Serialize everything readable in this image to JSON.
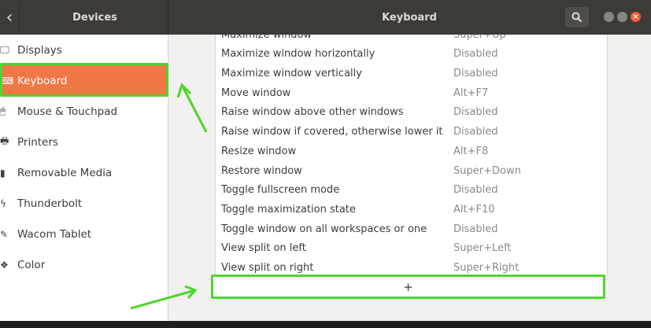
{
  "header": {
    "back_glyph": "‹",
    "left_title": "Devices",
    "main_title": "Keyboard",
    "close_glyph": "×"
  },
  "sidebar": {
    "items": [
      {
        "label": "Displays",
        "icon": "display-icon",
        "glyph": "🖵"
      },
      {
        "label": "Keyboard",
        "icon": "keyboard-icon",
        "glyph": "⌨",
        "active": true
      },
      {
        "label": "Mouse & Touchpad",
        "icon": "mouse-icon",
        "glyph": "🖱"
      },
      {
        "label": "Printers",
        "icon": "printer-icon",
        "glyph": "🖶"
      },
      {
        "label": "Removable Media",
        "icon": "usb-drive-icon",
        "glyph": "▮"
      },
      {
        "label": "Thunderbolt",
        "icon": "thunderbolt-icon",
        "glyph": "ϟ"
      },
      {
        "label": "Wacom Tablet",
        "icon": "tablet-icon",
        "glyph": "✎"
      },
      {
        "label": "Color",
        "icon": "color-icon",
        "glyph": "❖"
      }
    ]
  },
  "shortcuts": [
    {
      "name": "Maximize window",
      "accel": "Super+Up"
    },
    {
      "name": "Maximize window horizontally",
      "accel": "Disabled"
    },
    {
      "name": "Maximize window vertically",
      "accel": "Disabled"
    },
    {
      "name": "Move window",
      "accel": "Alt+F7"
    },
    {
      "name": "Raise window above other windows",
      "accel": "Disabled"
    },
    {
      "name": "Raise window if covered, otherwise lower it",
      "accel": "Disabled"
    },
    {
      "name": "Resize window",
      "accel": "Alt+F8"
    },
    {
      "name": "Restore window",
      "accel": "Super+Down"
    },
    {
      "name": "Toggle fullscreen mode",
      "accel": "Disabled"
    },
    {
      "name": "Toggle maximization state",
      "accel": "Alt+F10"
    },
    {
      "name": "Toggle window on all workspaces or one",
      "accel": "Disabled"
    },
    {
      "name": "View split on left",
      "accel": "Super+Left"
    },
    {
      "name": "View split on right",
      "accel": "Super+Right"
    }
  ],
  "add_button": {
    "label": "+"
  },
  "colors": {
    "accent": "#f07746",
    "highlight": "#4ed62c",
    "header": "#3c3b37"
  }
}
